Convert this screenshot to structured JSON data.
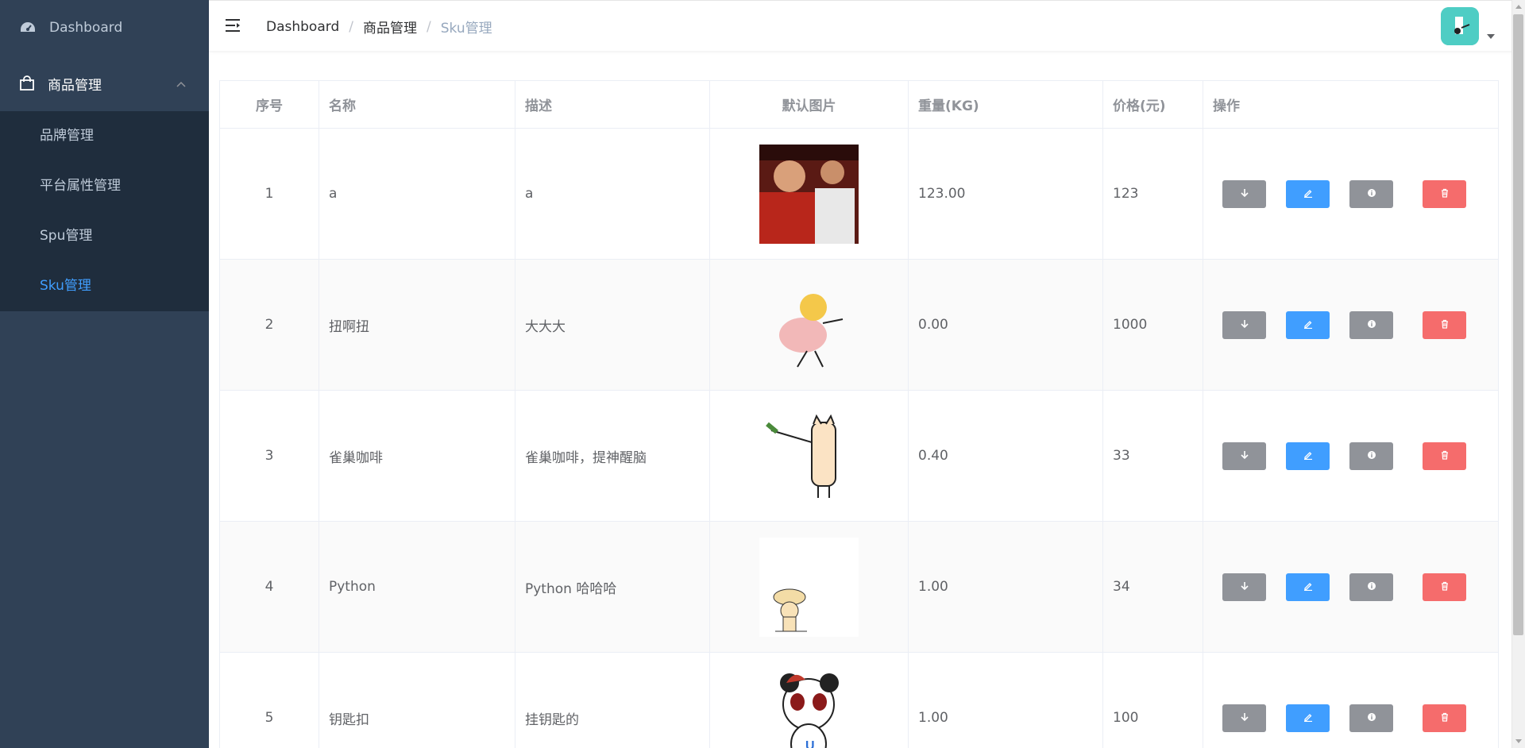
{
  "sidebar": {
    "dashboard_label": "Dashboard",
    "group_label": "商品管理",
    "items": [
      {
        "label": "品牌管理"
      },
      {
        "label": "平台属性管理"
      },
      {
        "label": "Spu管理"
      },
      {
        "label": "Sku管理",
        "active": true
      }
    ]
  },
  "header": {
    "breadcrumb": [
      "Dashboard",
      "商品管理",
      "Sku管理"
    ],
    "separator": "/"
  },
  "table": {
    "columns": [
      "序号",
      "名称",
      "描述",
      "默认图片",
      "重量(KG)",
      "价格(元)",
      "操作"
    ],
    "rows": [
      {
        "index": "1",
        "name": "a",
        "desc": "a",
        "image": "photo-two-people",
        "weight": "123.00",
        "price": "123"
      },
      {
        "index": "2",
        "name": "扭啊扭",
        "desc": "大大大",
        "image": "dancing-cartoon",
        "weight": "0.00",
        "price": "1000"
      },
      {
        "index": "3",
        "name": "雀巢咖啡",
        "desc": "雀巢咖啡，提神醒脑",
        "image": "cat-with-leek",
        "weight": "0.40",
        "price": "33"
      },
      {
        "index": "4",
        "name": "Python",
        "desc": "Python 哈哈哈",
        "image": "small-cartoon-character",
        "weight": "1.00",
        "price": "34"
      },
      {
        "index": "5",
        "name": "钥匙扣",
        "desc": "挂钥匙的",
        "image": "panda-mascot",
        "weight": "1.00",
        "price": "100"
      }
    ]
  },
  "colors": {
    "sidebar_bg": "#304156",
    "submenu_bg": "#1f2d3d",
    "active": "#409eff",
    "gray_button": "#909399",
    "blue_button": "#409eff",
    "red_button": "#f56c6c",
    "avatar": "#4ecdc4"
  }
}
